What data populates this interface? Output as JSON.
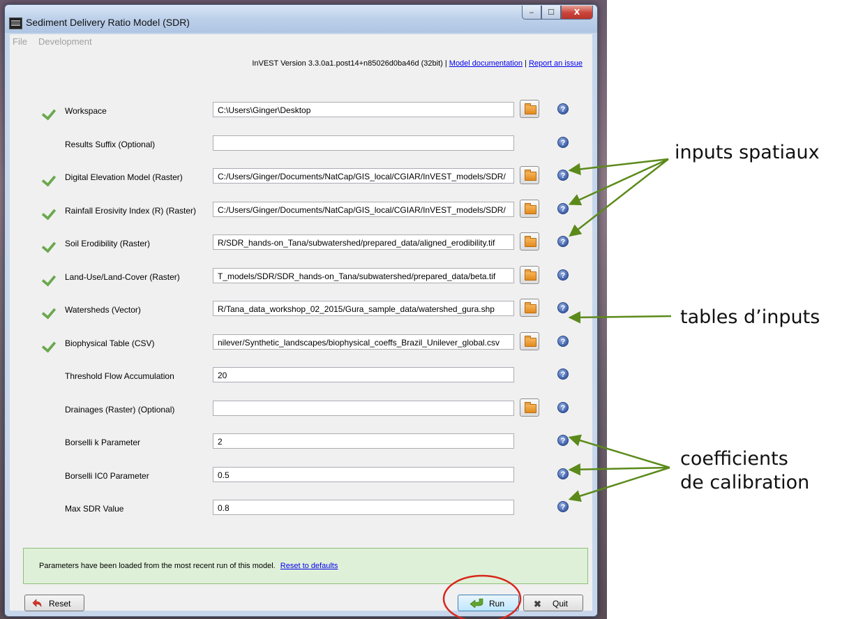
{
  "window": {
    "title": "Sediment Delivery Ratio Model (SDR)",
    "buttons": {
      "minimize": "‒",
      "maximize": "☐",
      "close": "X"
    }
  },
  "menu": {
    "file": "File",
    "development": "Development"
  },
  "version": {
    "text": "InVEST Version 3.3.0a1.post14+n85026d0ba46d (32bit) |",
    "doc_link": "Model documentation",
    "separator": "|",
    "issue_link": "Report an issue"
  },
  "fields": [
    {
      "label": "Workspace",
      "value": "C:\\Users\\Ginger\\Desktop",
      "valid": true
    },
    {
      "label": "Results Suffix (Optional)",
      "value": "",
      "valid": false
    },
    {
      "label": "Digital Elevation Model (Raster)",
      "value": "C:/Users/Ginger/Documents/NatCap/GIS_local/CGIAR/InVEST_models/SDR/",
      "valid": true
    },
    {
      "label": "Rainfall Erosivity Index (R) (Raster)",
      "value": "C:/Users/Ginger/Documents/NatCap/GIS_local/CGIAR/InVEST_models/SDR/",
      "valid": true
    },
    {
      "label": "Soil Erodibility (Raster)",
      "value": "R/SDR_hands-on_Tana/subwatershed/prepared_data/aligned_erodibility.tif",
      "valid": true
    },
    {
      "label": "Land-Use/Land-Cover (Raster)",
      "value": "T_models/SDR/SDR_hands-on_Tana/subwatershed/prepared_data/beta.tif",
      "valid": true
    },
    {
      "label": "Watersheds (Vector)",
      "value": "R/Tana_data_workshop_02_2015/Gura_sample_data/watershed_gura.shp",
      "valid": true
    },
    {
      "label": "Biophysical Table (CSV)",
      "value": "nilever/Synthetic_landscapes/biophysical_coeffs_Brazil_Unilever_global.csv",
      "valid": true
    },
    {
      "label": "Threshold Flow Accumulation",
      "value": "20",
      "valid": false
    },
    {
      "label": "Drainages (Raster) (Optional)",
      "value": "",
      "valid": false
    },
    {
      "label": "Borselli k Parameter",
      "value": "2",
      "valid": false
    },
    {
      "label": "Borselli IC0 Parameter",
      "value": "0.5",
      "valid": false
    },
    {
      "label": "Max SDR Value",
      "value": "0.8",
      "valid": false
    }
  ],
  "help_glyph": "?",
  "status": {
    "message": "Parameters have been loaded from the most recent run of this model.",
    "link": "Reset to defaults"
  },
  "buttons": {
    "reset": "Reset",
    "run": "Run",
    "quit": "Quit",
    "quit_glyph": "✖"
  },
  "annotations": {
    "spatial": "inputs spatiaux",
    "tables": "tables d’inputs",
    "coef_line1": "coefficients",
    "coef_line2": "de calibration"
  },
  "colors": {
    "arrow": "#5b8a1a",
    "highlight_circle": "#d9261c",
    "check": "#6aa84f"
  }
}
